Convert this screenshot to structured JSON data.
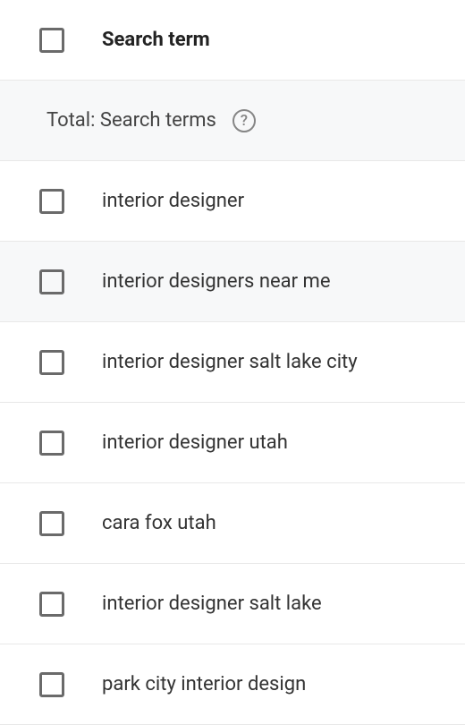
{
  "header": {
    "column_label": "Search term"
  },
  "total_row": {
    "label": "Total: Search terms"
  },
  "rows": [
    {
      "term": "interior designer"
    },
    {
      "term": "interior designers near me"
    },
    {
      "term": "interior designer salt lake city"
    },
    {
      "term": "interior designer utah"
    },
    {
      "term": "cara fox utah"
    },
    {
      "term": "interior designer salt lake"
    },
    {
      "term": "park city interior design"
    }
  ]
}
